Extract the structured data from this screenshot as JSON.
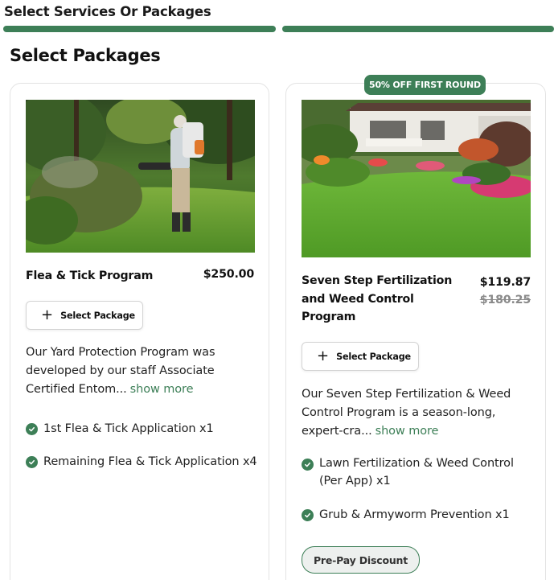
{
  "header": {
    "title": "Select Services Or Packages"
  },
  "section": {
    "title": "Select Packages"
  },
  "packages": [
    {
      "title": "Flea & Tick Program",
      "price": "$250.00",
      "select_label": "Select Package",
      "description": "Our Yard Protection Program was developed by our staff Associate Certified Entom...",
      "show_more": "show more",
      "features": [
        "1st Flea & Tick Application x1",
        "Remaining Flea & Tick Application x4"
      ]
    },
    {
      "badge": "50% OFF FIRST ROUND",
      "title": "Seven Step Fertilization and Weed Control Program",
      "price": "$119.87",
      "old_price": "$180.25",
      "select_label": "Select Package",
      "description": "Our Seven Step Fertilization & Weed Control Program is a season-long, expert-cra...",
      "show_more": "show more",
      "features": [
        "Lawn Fertilization & Weed Control (Per App) x1",
        "Grub & Armyworm Prevention x1"
      ],
      "prepay_label": "Pre-Pay Discount"
    }
  ],
  "colors": {
    "accent": "#3d7f57",
    "text": "#1a1a1a",
    "border": "#e3e3e3"
  },
  "icons": {
    "select": "plus-icon",
    "feature": "check-circle-icon"
  }
}
